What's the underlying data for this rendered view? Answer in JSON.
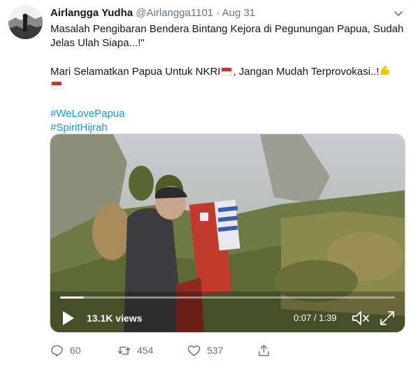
{
  "tweet": {
    "author": {
      "name": "Airlangga Yudha",
      "handle": "@Airlangga1101",
      "separator": "·",
      "date": "Aug 31"
    },
    "text": {
      "line1": "Masalah Pengibaran Bendera Bintang Kejora di Pegunungan Papua, Sudah",
      "line2": "Jelas Ulah Siapa...!\"",
      "line3": "Mari Selamatkan Papua Untuk NKRI",
      "line3b": ", Jangan Mudah Terprovokasi..!",
      "hashtag1": "#WeLovePapua",
      "hashtag2": "#SpiritHijrah"
    },
    "media": {
      "views": "13.1K views",
      "time": "0:07 / 1:39",
      "progress": 0.07
    },
    "actions": {
      "replies": "60",
      "retweets": "454",
      "likes": "537"
    },
    "icons": {
      "emoji_flag": "indonesia-flag-emoji",
      "emoji_muscle": "flexed-biceps-emoji",
      "menu": "chevron-down-icon",
      "reply": "reply-icon",
      "retweet": "retweet-icon",
      "like": "heart-icon",
      "share": "share-icon"
    },
    "colors": {
      "link": "#1b95e0",
      "muted": "#657786"
    }
  }
}
